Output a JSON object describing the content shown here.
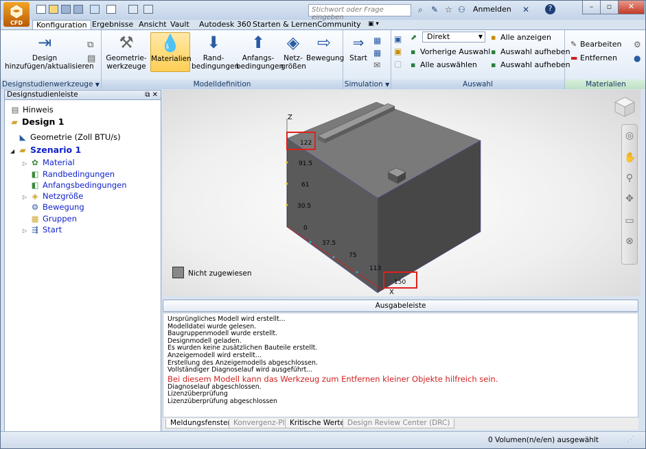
{
  "app": {
    "label": "CFD",
    "search_placeholder": "Stichwort oder Frage eingeben",
    "signin": "Anmelden",
    "help": "?"
  },
  "tabs": [
    "Konfiguration",
    "Ergebnisse",
    "Ansicht",
    "Vault",
    "Autodesk 360",
    "Starten & Lernen",
    "Community"
  ],
  "ribbon": {
    "design_btn": "Design hinzufügen/aktualisieren",
    "design_group": "Designstudienwerkzeuge",
    "geo_btn": "Geometrie-werkzeuge",
    "materials_btn": "Materialien",
    "boundary_btn": "Rand-bedingungen",
    "initial_btn": "Anfangs-bedingungen",
    "mesh_btn": "Netz-größen",
    "motion_btn": "Bewegung",
    "modeldef_group": "Modelldefinition",
    "start_btn": "Start",
    "simulation_group": "Simulation",
    "direkt": "Direkt",
    "vorherige": "Vorherige Auswahl",
    "alle_auswaehlen": "Alle auswählen",
    "alle_anzeigen": "Alle anzeigen",
    "auswahl_aufheben": "Auswahl aufheben",
    "auswahl_group": "Auswahl",
    "bearbeiten": "Bearbeiten",
    "entfernen": "Entfernen",
    "materialien_group": "Materialien"
  },
  "panel": {
    "title": "Designstudienleiste",
    "items": [
      "Hinweis",
      "Design 1",
      "Geometrie (Zoll BTU/s)",
      "Szenario 1",
      "Material",
      "Randbedingungen",
      "Anfangsbedingungen",
      "Netzgröße",
      "Bewegung",
      "Gruppen",
      "Start"
    ]
  },
  "viewport": {
    "axis_z": "Z",
    "axis_x": "X",
    "z_ticks": [
      "122",
      "91.5",
      "61",
      "30.5",
      "0"
    ],
    "x_ticks": [
      "37.5",
      "75",
      "113",
      "150"
    ],
    "legend": "Nicht zugewiesen",
    "highlight_color": "#e0201c",
    "body_color": "#5b5b5b"
  },
  "output": {
    "title": "Ausgabeleiste",
    "lines": [
      "Ursprüngliches Modell wird erstellt...",
      "Modelldatei wurde gelesen.",
      "Baugruppenmodell wurde erstellt.",
      "Designmodell geladen.",
      "Es wurden keine zusätzlichen Bauteile erstellt.",
      "Anzeigemodell wird erstellt...",
      "Erstellung des Anzeigemodells abgeschlossen.",
      "Vollständiger Diagnoselauf wird ausgeführt..."
    ],
    "warning": "Bei diesem Modell kann das Werkzeug zum Entfernen kleiner Objekte hilfreich sein.",
    "lines2": [
      "Diagnoselauf abgeschlossen.",
      "Lizenzüberprüfung",
      "Lizenzüberprüfung abgeschlossen"
    ]
  },
  "bottom_tabs": [
    "Meldungsfenster",
    "Konvergenz-Plot",
    "Kritische Werte",
    "Design Review Center (DRC)"
  ],
  "status": "0 Volumen(n/e/en) ausgewählt"
}
